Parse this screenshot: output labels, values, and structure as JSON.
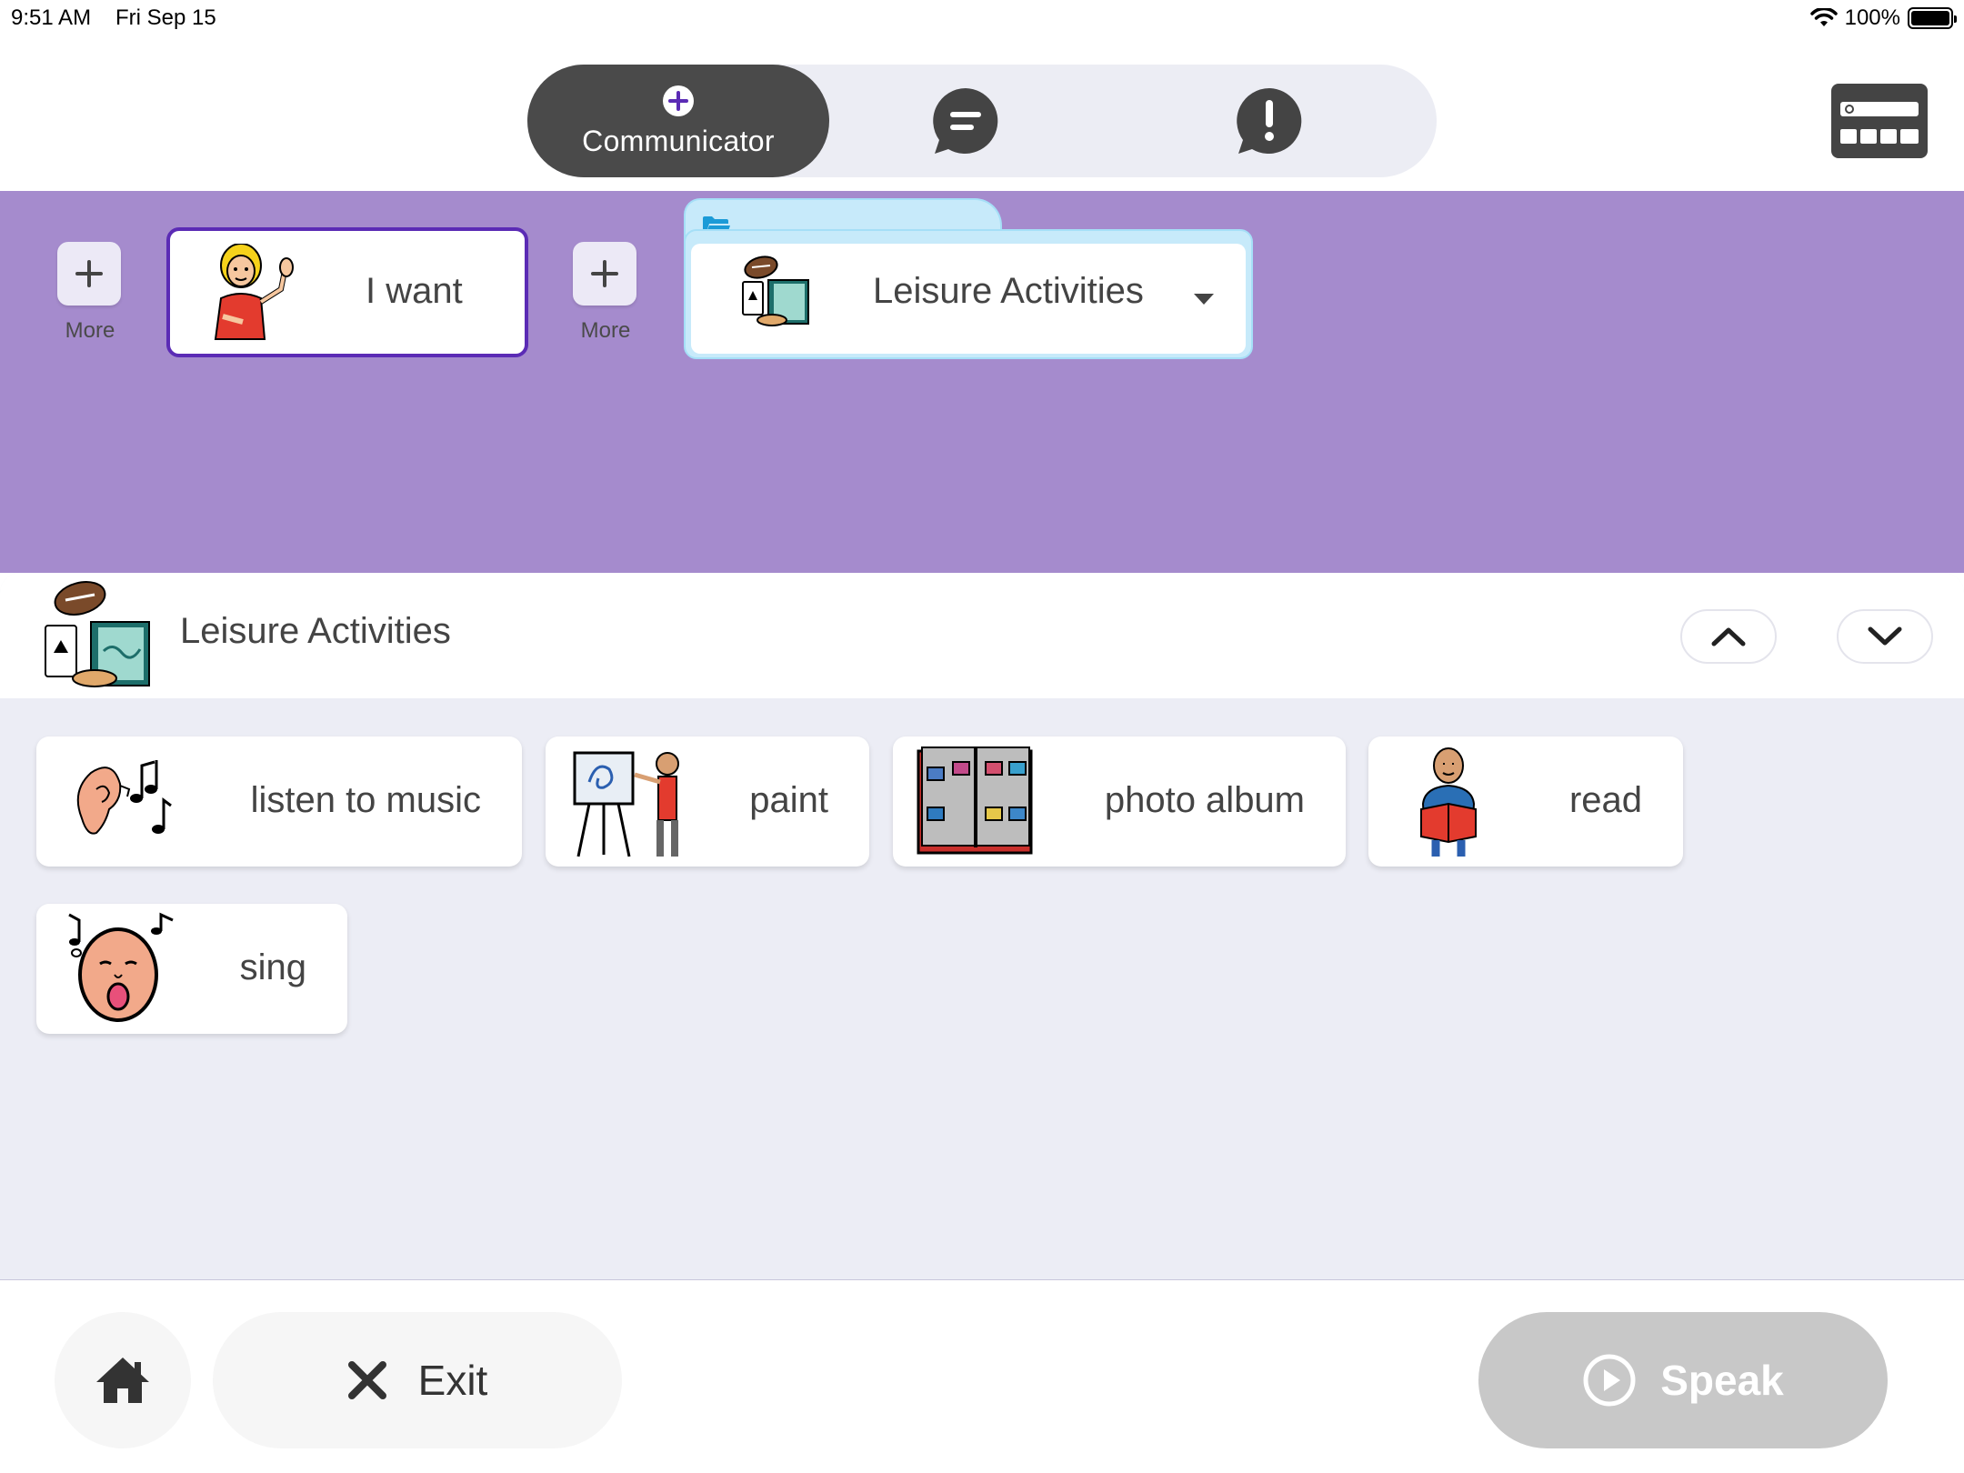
{
  "status_bar": {
    "time": "9:51 AM",
    "date": "Fri Sep 15",
    "battery": "100%",
    "battery_level": 1.0
  },
  "mode_switch": {
    "tabs": [
      {
        "label": "Communicator",
        "icon": "plus-circle-icon",
        "active": true
      },
      {
        "label": "",
        "icon": "chat-bubble-icon",
        "active": false
      },
      {
        "label": "",
        "icon": "alert-bubble-icon",
        "active": false
      }
    ]
  },
  "keyboard": {
    "icon": "keyboard-icon"
  },
  "sentence": {
    "more_label": "More",
    "items": [
      {
        "label": "I want",
        "icon": "person-waving-icon"
      },
      {
        "label": "Leisure Activities",
        "icon": "leisure-activities-icon",
        "is_folder": true
      }
    ]
  },
  "board": {
    "title": "Leisure Activities",
    "icon": "leisure-activities-icon",
    "tiles": [
      {
        "label": "listen to music",
        "icon": "ear-music-icon"
      },
      {
        "label": "paint",
        "icon": "painter-easel-icon"
      },
      {
        "label": "photo album",
        "icon": "photo-album-icon"
      },
      {
        "label": "read",
        "icon": "person-reading-icon"
      },
      {
        "label": "sing",
        "icon": "singing-face-icon"
      }
    ]
  },
  "bottom_bar": {
    "exit_label": "Exit",
    "speak_label": "Speak"
  },
  "colors": {
    "accent_purple": "#a58bcd",
    "selected_border": "#5b2bb5",
    "folder_blue": "#c7eafa",
    "board_bg": "#ecedf5",
    "speak_disabled": "#c8c8c8",
    "dark_pill": "#4a4a4a"
  }
}
